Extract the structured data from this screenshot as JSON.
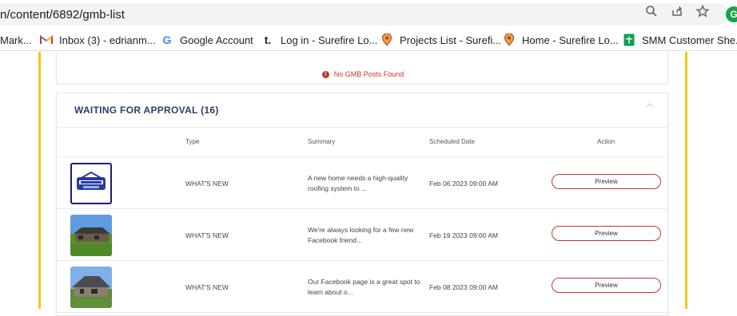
{
  "browser": {
    "url": "n/content/6892/gmb-list",
    "bookmarks": [
      {
        "label": "Mark...",
        "icon": "none"
      },
      {
        "label": "Inbox (3) - edrianm...",
        "icon": "gmail-icon"
      },
      {
        "label": "Google Account",
        "icon": "google-icon"
      },
      {
        "label": "Log in - Surefire Lo...",
        "icon": "t-icon"
      },
      {
        "label": "Projects List - Surefi...",
        "icon": "location-pin-icon"
      },
      {
        "label": "Home - Surefire Lo...",
        "icon": "location-pin-icon"
      },
      {
        "label": "SMM Customer She...",
        "icon": "sheets-icon"
      }
    ]
  },
  "posted_panel": {
    "empty_message": "No GMB Posts Found"
  },
  "waiting_panel": {
    "title": "WAITING FOR APPROVAL (16)",
    "columns": {
      "type": "Type",
      "summary": "Summary",
      "scheduled": "Scheduled Date",
      "action": "Action"
    },
    "rows": [
      {
        "type": "WHAT'S NEW",
        "summary": "A new home needs a high-quality roofing system to ...",
        "date": "Feb 06 2023 09:00 AM",
        "action": "Preview",
        "thumb": "logo"
      },
      {
        "type": "WHAT'S NEW",
        "summary": "We're always looking for a few new Facebook friend...",
        "date": "Feb 19 2023 09:00 AM",
        "action": "Preview",
        "thumb": "house"
      },
      {
        "type": "WHAT'S NEW",
        "summary": "Our Facebook page is a great spot to learn about o...",
        "date": "Feb 08 2023 09:00 AM",
        "action": "Preview",
        "thumb": "house2"
      }
    ]
  },
  "colors": {
    "accent": "#f5c518",
    "danger": "#c0392b",
    "title": "#2b3f6b"
  }
}
